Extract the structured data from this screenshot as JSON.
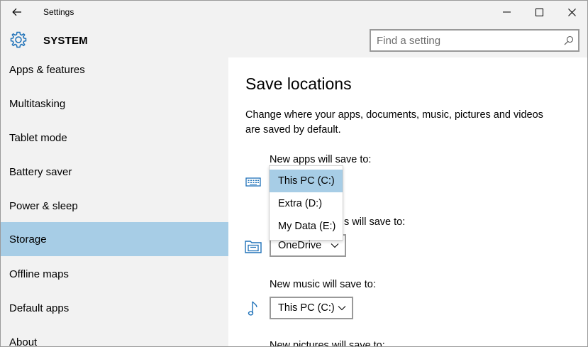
{
  "window": {
    "title": "Settings"
  },
  "titlebar": {
    "back_icon": "arrow-left-icon",
    "minimize_icon": "minimize-icon",
    "maximize_icon": "maximize-icon",
    "close_icon": "close-icon"
  },
  "header": {
    "icon": "gear-icon",
    "title": "SYSTEM",
    "search_placeholder": "Find a setting",
    "search_value": ""
  },
  "sidebar": {
    "items": [
      {
        "label": "Apps & features"
      },
      {
        "label": "Multitasking"
      },
      {
        "label": "Tablet mode"
      },
      {
        "label": "Battery saver"
      },
      {
        "label": "Power & sleep"
      },
      {
        "label": "Storage",
        "selected": true
      },
      {
        "label": "Offline maps"
      },
      {
        "label": "Default apps"
      },
      {
        "label": "About"
      }
    ]
  },
  "main": {
    "title": "Save locations",
    "description": "Change where your apps, documents, music, pictures and videos are saved by default.",
    "fields": [
      {
        "label": "New apps will save to:",
        "value": "This PC (C:)",
        "icon": "apps-keyboard-icon"
      },
      {
        "label": "New documents will save to:",
        "label_visible": "s will save to:",
        "value": "OneDrive",
        "icon": "documents-icon"
      },
      {
        "label": "New music will save to:",
        "value": "This PC (C:)",
        "icon": "music-note-icon"
      },
      {
        "label": "New pictures will save to:",
        "value": ""
      }
    ],
    "dropdown_open": {
      "options": [
        {
          "label": "This PC (C:)",
          "highlighted": true
        },
        {
          "label": "Extra (D:)"
        },
        {
          "label": "My Data (E:)"
        }
      ]
    }
  },
  "colors": {
    "chrome": "#f2f2f2",
    "selection": "#a7cde6",
    "accent_icon": "#1e71b8"
  }
}
